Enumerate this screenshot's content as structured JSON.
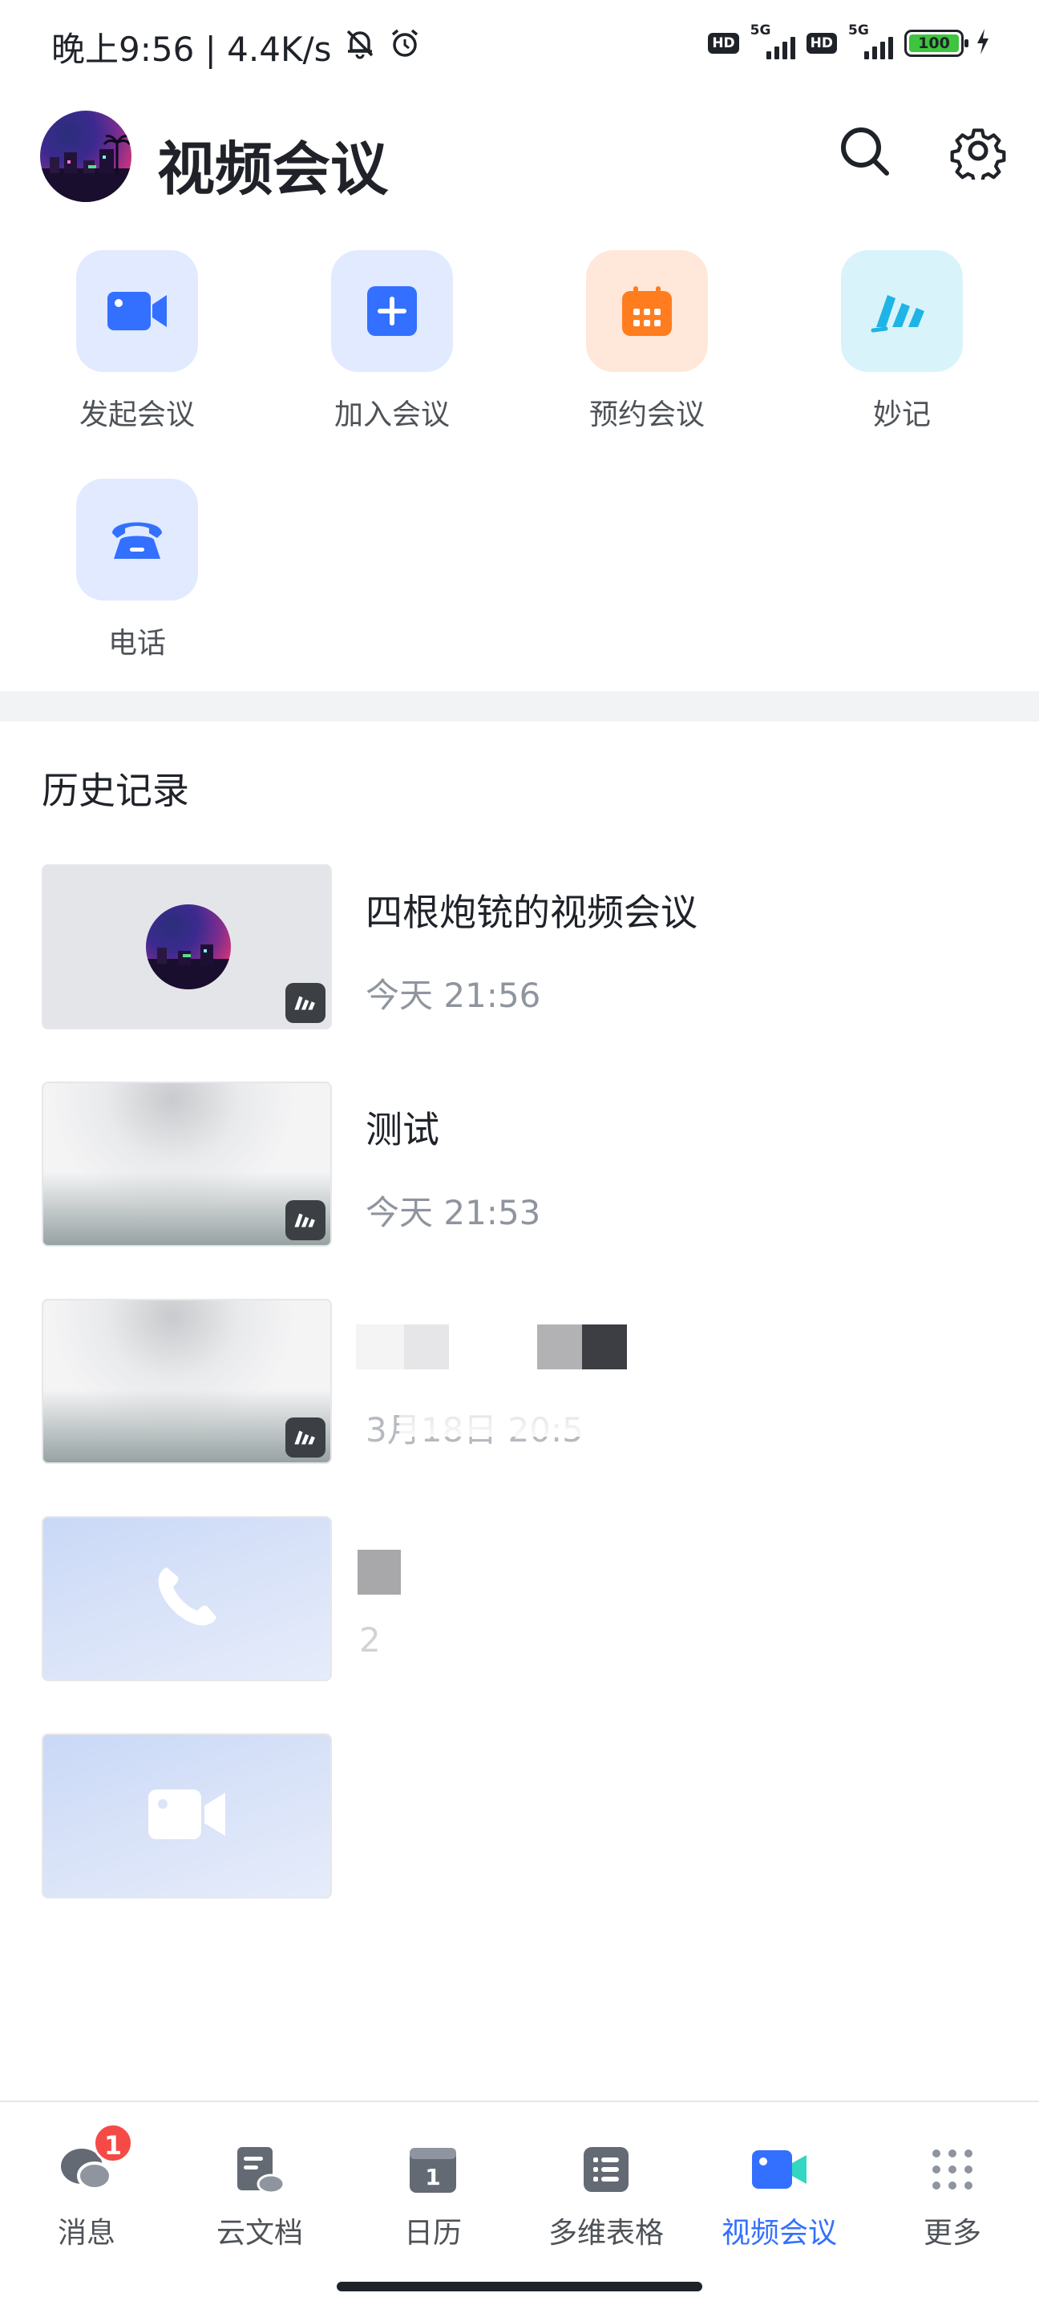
{
  "status_bar": {
    "time_speed": "晚上9:56 | 4.4K/s",
    "hd_label": "HD",
    "network_label": "5G",
    "battery": "100"
  },
  "header": {
    "title": "视频会议"
  },
  "actions": [
    {
      "label": "发起会议",
      "icon": "video-camera-icon",
      "bg": "#e1eaff",
      "fg": "#3370ff"
    },
    {
      "label": "加入会议",
      "icon": "plus-icon",
      "bg": "#e1eaff",
      "fg": "#3370ff"
    },
    {
      "label": "预约会议",
      "icon": "calendar-icon",
      "bg": "#ffe8d9",
      "fg": "#ff7d1f"
    },
    {
      "label": "妙记",
      "icon": "minutes-icon",
      "bg": "#d9f3fa",
      "fg": "#1fb4e6"
    },
    {
      "label": "电话",
      "icon": "phone-icon",
      "bg": "#e1eaff",
      "fg": "#3370ff"
    }
  ],
  "history": {
    "title": "历史记录",
    "items": [
      {
        "title": "四根炮铳的视频会议",
        "time": "今天 21:56"
      },
      {
        "title": "测试",
        "time": "今天 21:53"
      },
      {
        "title": "",
        "time": "3月18日 20:5"
      },
      {
        "title": "",
        "time": "2"
      },
      {
        "title": "",
        "time": ""
      }
    ]
  },
  "tabbar": {
    "items": [
      {
        "label": "消息",
        "badge": "1"
      },
      {
        "label": "云文档"
      },
      {
        "label": "日历",
        "day": "1"
      },
      {
        "label": "多维表格"
      },
      {
        "label": "视频会议"
      },
      {
        "label": "更多"
      }
    ]
  },
  "colors": {
    "accent": "#3370ff",
    "text_primary": "#1f2329",
    "text_secondary": "#8f959e",
    "badge_red": "#f54a45"
  }
}
